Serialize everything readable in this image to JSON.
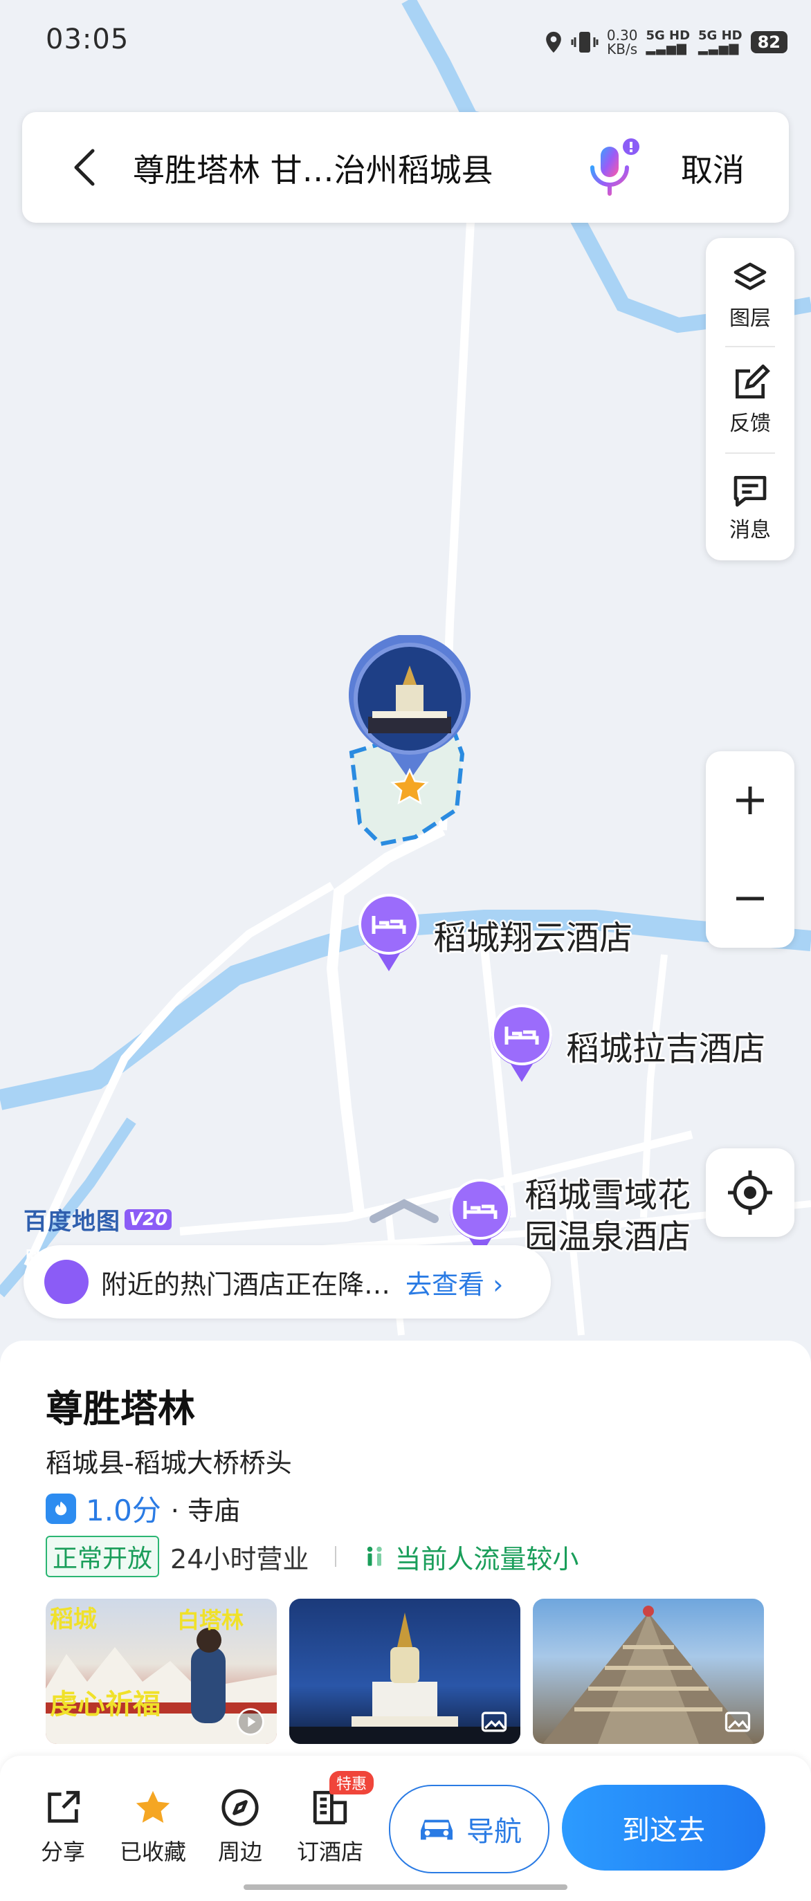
{
  "status_bar": {
    "time": "03:05",
    "net_speed_value": "0.30",
    "net_speed_unit": "KB/s",
    "sim1": "5G HD",
    "sim2": "5G HD",
    "battery": "82"
  },
  "search": {
    "query": "尊胜塔林 甘…治州稻城县",
    "cancel_label": "取消"
  },
  "map_tools": {
    "layers_label": "图层",
    "feedback_label": "反馈",
    "messages_label": "消息"
  },
  "map": {
    "hotels": [
      {
        "name": "稻城翔云酒店"
      },
      {
        "name": "稻城拉吉酒店"
      },
      {
        "name_line1": "稻城雪域花",
        "name_line2": "园温泉酒店"
      }
    ],
    "brand": "百度地图",
    "brand_version": "V20",
    "promo_text": "附近的热门酒店正在降…",
    "promo_link": "去查看"
  },
  "place": {
    "name": "尊胜塔林",
    "address": "稻城县-稻城大桥桥头",
    "rating": "1.0分",
    "category": "· 寺庙",
    "open_status": "正常开放",
    "hours": "24小时营业",
    "crowd": "当前人流量较小",
    "photo_text_1": "稻城",
    "photo_text_2": "白塔林",
    "photo_text_3": "虔心祈福"
  },
  "actions": {
    "share": "分享",
    "saved": "已收藏",
    "nearby": "周边",
    "book_hotel": "订酒店",
    "special_tag": "特惠",
    "navigate": "导航",
    "go_here": "到这去"
  },
  "colors": {
    "accent": "#2a7be4",
    "hotel_pin": "#8b5cf6",
    "open_green": "#1a9e5a",
    "river": "#a9d3f5"
  }
}
